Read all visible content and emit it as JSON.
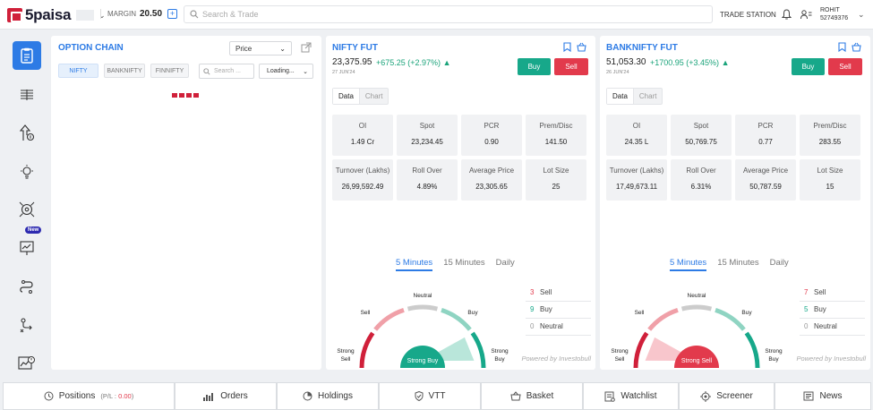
{
  "topbar": {
    "logo_text": "5paisa",
    "margin_label": "MARGIN",
    "margin_value": "20.50",
    "search_placeholder": "Search & Trade",
    "trade_station": "TRADE STATION",
    "user_name": "ROHIT",
    "user_id": "52749376"
  },
  "sidebar": {
    "items": [
      "option-chain",
      "list",
      "upload-chart",
      "ideas",
      "target",
      "screener-chart",
      "strategy",
      "flow",
      "analytics"
    ],
    "new_badge": "New"
  },
  "option_chain": {
    "title": "OPTION CHAIN",
    "select_value": "Price",
    "chips": [
      "NIFTY",
      "BANKNIFTY",
      "FINNIFTY"
    ],
    "search_placeholder": "Search ...",
    "loading": "Loading..."
  },
  "futures": [
    {
      "title": "NIFTY FUT",
      "price": "23,375.95",
      "change": "+675.25 (+2.97%)",
      "date": "27 JUN'24",
      "buy": "Buy",
      "sell": "Sell",
      "tabs_data": "Data",
      "tabs_chart": "Chart",
      "stats": [
        {
          "label": "OI",
          "value": "1.49 Cr"
        },
        {
          "label": "Spot",
          "value": "23,234.45"
        },
        {
          "label": "PCR",
          "value": "0.90"
        },
        {
          "label": "Prem/Disc",
          "value": "141.50"
        },
        {
          "label": "Turnover (Lakhs)",
          "value": "26,99,592.49"
        },
        {
          "label": "Roll Over",
          "value": "4.89%"
        },
        {
          "label": "Average Price",
          "value": "23,305.65"
        },
        {
          "label": "Lot Size",
          "value": "25"
        }
      ],
      "time_tabs": [
        "5 Minutes",
        "15 Minutes",
        "Daily"
      ],
      "gauge_labels": {
        "strong_sell": [
          "Strong",
          "Sell"
        ],
        "sell": "Sell",
        "neutral": "Neutral",
        "buy": "Buy",
        "strong_buy": [
          "Strong",
          "Buy"
        ]
      },
      "gauge_result": "Strong Buy",
      "gauge_color": "#17a88a",
      "legend": [
        {
          "count": "3",
          "label": "Sell",
          "color": "#e23a4c"
        },
        {
          "count": "9",
          "label": "Buy",
          "color": "#17a88a"
        },
        {
          "count": "0",
          "label": "Neutral",
          "color": "#999999"
        }
      ],
      "powered": "Powered by Investobull"
    },
    {
      "title": "BANKNIFTY FUT",
      "price": "51,053.30",
      "change": "+1700.95 (+3.45%)",
      "date": "26 JUN'24",
      "buy": "Buy",
      "sell": "Sell",
      "tabs_data": "Data",
      "tabs_chart": "Chart",
      "stats": [
        {
          "label": "OI",
          "value": "24.35 L"
        },
        {
          "label": "Spot",
          "value": "50,769.75"
        },
        {
          "label": "PCR",
          "value": "0.77"
        },
        {
          "label": "Prem/Disc",
          "value": "283.55"
        },
        {
          "label": "Turnover (Lakhs)",
          "value": "17,49,673.11"
        },
        {
          "label": "Roll Over",
          "value": "6.31%"
        },
        {
          "label": "Average Price",
          "value": "50,787.59"
        },
        {
          "label": "Lot Size",
          "value": "15"
        }
      ],
      "time_tabs": [
        "5 Minutes",
        "15 Minutes",
        "Daily"
      ],
      "gauge_labels": {
        "strong_sell": [
          "Strong",
          "Sell"
        ],
        "sell": "Sell",
        "neutral": "Neutral",
        "buy": "Buy",
        "strong_buy": [
          "Strong",
          "Buy"
        ]
      },
      "gauge_result": "Strong Sell",
      "gauge_color": "#e23a4c",
      "legend": [
        {
          "count": "7",
          "label": "Sell",
          "color": "#e23a4c"
        },
        {
          "count": "5",
          "label": "Buy",
          "color": "#17a88a"
        },
        {
          "count": "0",
          "label": "Neutral",
          "color": "#999999"
        }
      ],
      "powered": "Powered by Investobull"
    }
  ],
  "bottombar": {
    "positions": "Positions",
    "positions_sub": "(P/L : ",
    "positions_val": "0.00",
    "positions_end": ")",
    "orders": "Orders",
    "holdings": "Holdings",
    "vtt": "VTT",
    "basket": "Basket",
    "watchlist": "Watchlist",
    "screener": "Screener",
    "news": "News"
  }
}
